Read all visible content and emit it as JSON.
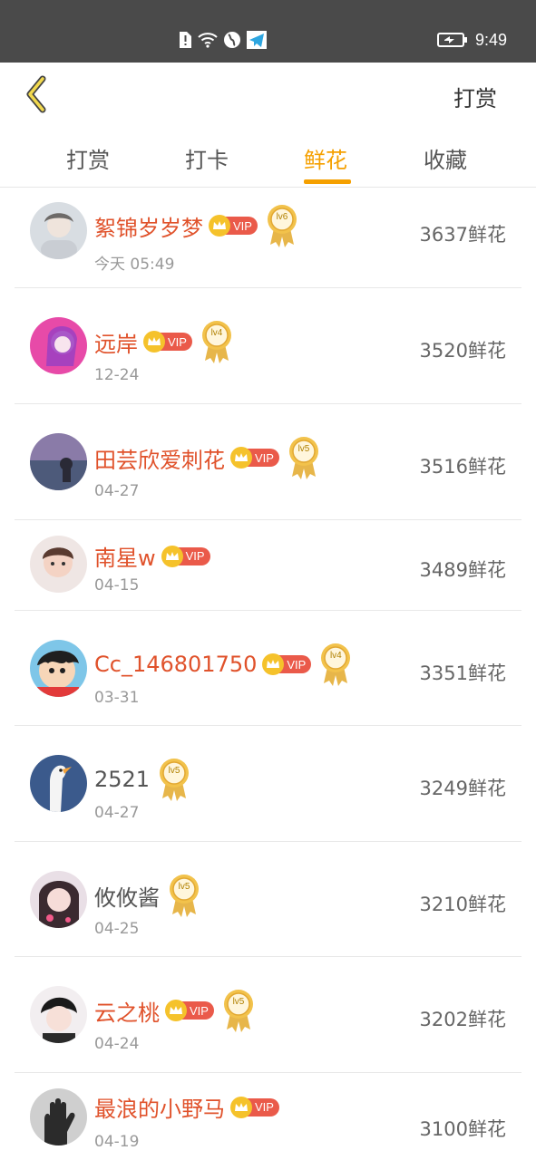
{
  "status_bar": {
    "time": "9:49",
    "icons": [
      "sim-alert-icon",
      "wifi-icon",
      "globe-icon",
      "telegram-icon"
    ],
    "battery_icon": "battery-charging-icon"
  },
  "header": {
    "back_icon": "chevron-left-icon",
    "action_label": "打赏"
  },
  "tabs": [
    {
      "label": "打赏",
      "active": false
    },
    {
      "label": "打卡",
      "active": false
    },
    {
      "label": "鲜花",
      "active": true
    },
    {
      "label": "收藏",
      "active": false
    }
  ],
  "ranking": [
    {
      "name": "絮锦岁岁梦",
      "vip": true,
      "level": "lv6",
      "date": "今天 05:49",
      "amount": "3637鲜花"
    },
    {
      "name": "远岸",
      "vip": true,
      "level": "lv4",
      "date": "12-24",
      "amount": "3520鲜花"
    },
    {
      "name": "田芸欣爱刺花",
      "vip": true,
      "level": "lv5",
      "date": "04-27",
      "amount": "3516鲜花"
    },
    {
      "name": "南星w",
      "vip": true,
      "level": "",
      "date": "04-15",
      "amount": "3489鲜花"
    },
    {
      "name": "Cc_146801750",
      "vip": true,
      "level": "lv4",
      "date": "03-31",
      "amount": "3351鲜花"
    },
    {
      "name": "2521",
      "vip": false,
      "level": "lv5",
      "date": "04-27",
      "amount": "3249鲜花"
    },
    {
      "name": "攸攸酱",
      "vip": false,
      "level": "lv5",
      "date": "04-25",
      "amount": "3210鲜花"
    },
    {
      "name": "云之桃",
      "vip": true,
      "level": "lv5",
      "date": "04-24",
      "amount": "3202鲜花"
    },
    {
      "name": "最浪的小野马",
      "vip": true,
      "level": "",
      "date": "04-19",
      "amount": "3100鲜花"
    }
  ],
  "vip_label": "VIP",
  "colors": {
    "accent": "#f5a000",
    "vip_name": "#e0522b",
    "status_bar": "#4a4a4a"
  }
}
